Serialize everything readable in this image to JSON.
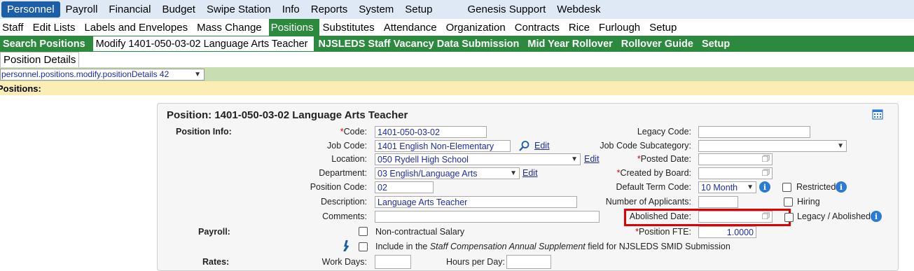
{
  "top_menu": {
    "items": [
      "Personnel",
      "Payroll",
      "Financial",
      "Budget",
      "Swipe Station",
      "Info",
      "Reports",
      "System",
      "Setup"
    ],
    "extra": [
      "Genesis Support",
      "Webdesk"
    ]
  },
  "sub_menu": {
    "items": [
      "Staff",
      "Edit Lists",
      "Labels and Envelopes",
      "Mass Change",
      "Positions",
      "Substitutes",
      "Attendance",
      "Organization",
      "Contracts",
      "Rice",
      "Furlough",
      "Setup"
    ]
  },
  "third_menu": {
    "items": [
      "Search Positions",
      "Modify 1401-050-03-02 Language Arts Teacher",
      "NJSLEDS Staff Vacancy Data Submission",
      "Mid Year Rollover",
      "Rollover Guide",
      "Setup"
    ]
  },
  "fourth_menu": {
    "items": [
      "Position Details"
    ]
  },
  "path_select": {
    "value": "personnel.positions.modify.positionDetails 42"
  },
  "section_header": "Positions:",
  "panel": {
    "title": "Position: 1401-050-03-02 Language Arts Teacher",
    "position_info_label": "Position Info:",
    "payroll_label": "Payroll:",
    "rates_label": "Rates:",
    "code": {
      "label": "Code:",
      "value": "1401-050-03-02"
    },
    "job_code": {
      "label": "Job Code:",
      "value": "1401 English Non-Elementary",
      "edit": "Edit"
    },
    "location": {
      "label": "Location:",
      "value": "050 Rydell High School",
      "edit": "Edit"
    },
    "department": {
      "label": "Department:",
      "value": "03 English/Language Arts",
      "edit": "Edit"
    },
    "position_code": {
      "label": "Position Code:",
      "value": "02"
    },
    "description": {
      "label": "Description:",
      "value": "Language Arts Teacher"
    },
    "comments": {
      "label": "Comments:",
      "value": ""
    },
    "legacy_code": {
      "label": "Legacy Code:",
      "value": ""
    },
    "job_code_subcategory": {
      "label": "Job Code Subcategory:",
      "value": ""
    },
    "posted_date": {
      "label": "Posted Date:",
      "value": ""
    },
    "created_by_board": {
      "label": "Created by Board:",
      "value": ""
    },
    "default_term_code": {
      "label": "Default Term Code:",
      "value": "10 Month"
    },
    "restricted": {
      "label": "Restricted"
    },
    "number_of_applicants": {
      "label": "Number of Applicants:",
      "value": ""
    },
    "hiring": {
      "label": "Hiring"
    },
    "abolished_date": {
      "label": "Abolished Date:",
      "value": ""
    },
    "legacy_abolished": {
      "label": "Legacy / Abolished"
    },
    "position_fte": {
      "label": "Position FTE:",
      "value": "1.0000"
    },
    "non_contractual_salary": {
      "label": "Non-contractual Salary"
    },
    "include_supplement": {
      "prefix": "Include in the",
      "italic": "Staff Compensation Annual Supplement",
      "suffix": "field for NJSLEDS SMID Submission"
    },
    "work_days": {
      "label": "Work Days:",
      "value": ""
    },
    "hours_per_day": {
      "label": "Hours per Day:",
      "value": ""
    }
  },
  "colors": {
    "top_menu_bg": "#dfe9f5",
    "top_active": "#1c5ea8",
    "green": "#2b8a3e",
    "path_bar": "#c8ddb2",
    "header_bar": "#fbeeb5",
    "highlight": "#e00000",
    "link": "#1d2da8"
  },
  "icons": [
    "calendar-icon",
    "search-icon",
    "info-icon",
    "calendar-picker-icon",
    "person-icon",
    "chevron-down-icon"
  ]
}
